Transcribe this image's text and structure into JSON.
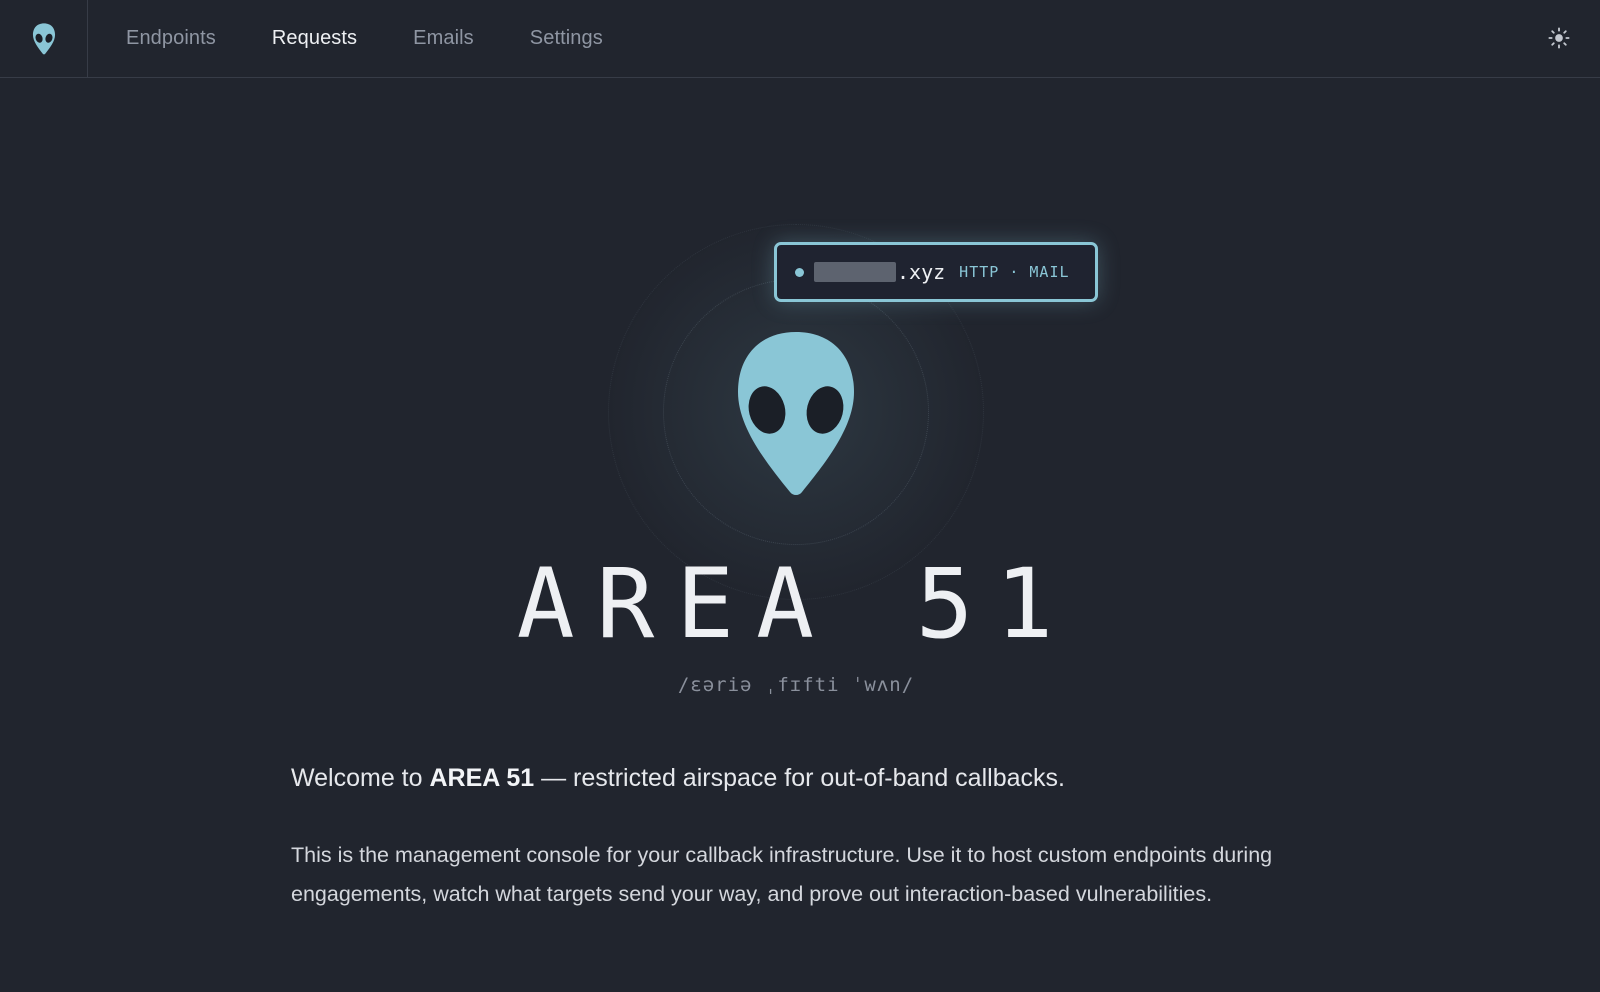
{
  "nav": {
    "items": [
      {
        "label": "Endpoints",
        "active": false
      },
      {
        "label": "Requests",
        "active": true
      },
      {
        "label": "Emails",
        "active": false
      },
      {
        "label": "Settings",
        "active": false
      }
    ],
    "logo_icon": "alien-head-icon",
    "theme_icon": "sun-icon"
  },
  "hero": {
    "domain_tld": ".xyz",
    "domain_protocols": "HTTP · MAIL",
    "title": "AREA 51",
    "phonetic": "/ɛəriə ˌfɪfti ˈwʌn/",
    "welcome_prefix": "Welcome to ",
    "welcome_brand": "AREA 51",
    "welcome_suffix": " — restricted airspace for out-of-band callbacks.",
    "description": "This is the management console for your callback infrastructure. Use it to host custom endpoints during engagements, watch what targets send your way, and prove out interaction-based vulnerabilities."
  },
  "colors": {
    "background": "#21252e",
    "accent": "#8ac6d6",
    "nav_inactive": "#8f96a3",
    "nav_active": "#eef0f3",
    "border": "#373c47"
  }
}
